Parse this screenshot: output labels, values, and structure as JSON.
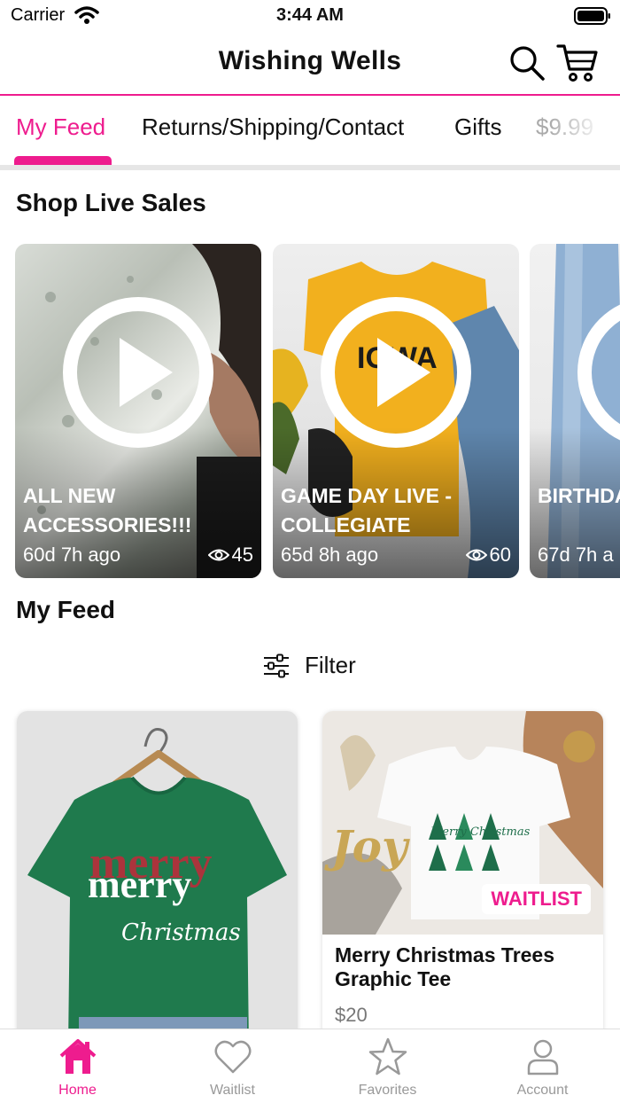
{
  "status_bar": {
    "carrier": "Carrier",
    "time": "3:44 AM"
  },
  "header": {
    "title": "Wishing Wells"
  },
  "tabs": [
    {
      "label": "My Feed",
      "active": true
    },
    {
      "label": "Returns/Shipping/Contact"
    },
    {
      "label": "Gifts"
    },
    {
      "label": "$9.99"
    }
  ],
  "live_sales": {
    "title": "Shop Live Sales",
    "cards": [
      {
        "title": "ALL NEW ACCESSORIES!!!",
        "time": "60d 7h ago",
        "views": "45"
      },
      {
        "title": "GAME DAY LIVE - COLLEGIATE",
        "time": "65d 8h ago",
        "views": "60"
      },
      {
        "title": "BIRTHDA Coupons",
        "time": "67d 7h a",
        "views": ""
      }
    ]
  },
  "feed": {
    "title": "My Feed",
    "filter_label": "Filter",
    "products": [
      {
        "name": "",
        "price": "",
        "badge": ""
      },
      {
        "name": "Merry Christmas Trees Graphic Tee",
        "price": "$20",
        "badge": "WAITLIST"
      }
    ]
  },
  "bottom_nav": [
    {
      "label": "Home",
      "icon": "home-icon",
      "active": true
    },
    {
      "label": "Waitlist",
      "icon": "heart-icon"
    },
    {
      "label": "Favorites",
      "icon": "star-icon"
    },
    {
      "label": "Account",
      "icon": "person-icon"
    }
  ],
  "colors": {
    "accent": "#ee1c8e",
    "tab_divider": "#e6e6e6"
  }
}
